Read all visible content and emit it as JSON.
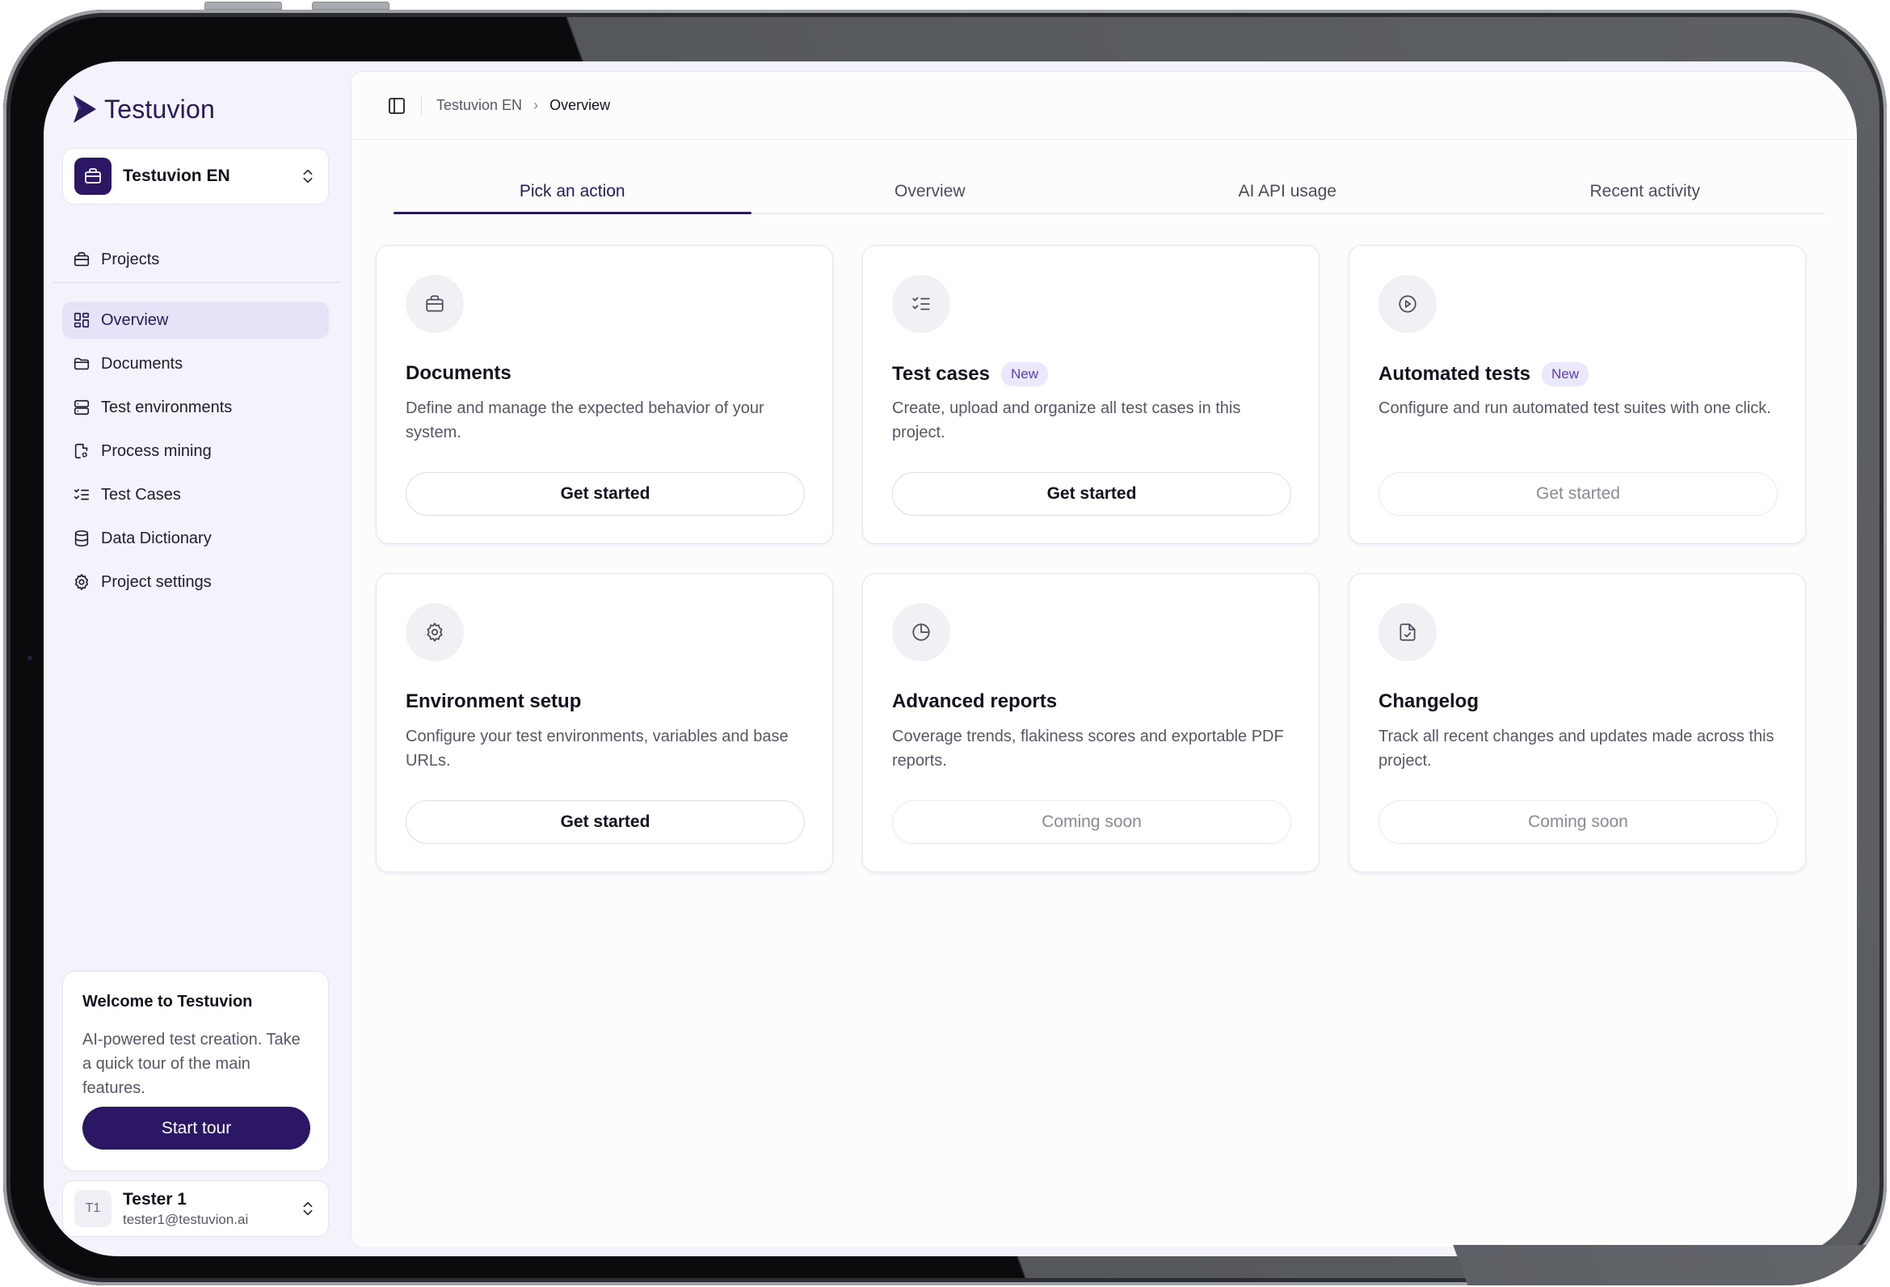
{
  "brand": {
    "name": "Testuvion"
  },
  "workspace": {
    "name": "Testuvion EN"
  },
  "sidebar": {
    "projects_label": "Projects",
    "items": [
      {
        "label": "Overview",
        "icon": "grid-icon"
      },
      {
        "label": "Documents",
        "icon": "folder-icon"
      },
      {
        "label": "Test environments",
        "icon": "server-icon"
      },
      {
        "label": "Process mining",
        "icon": "file-search-icon"
      },
      {
        "label": "Test Cases",
        "icon": "list-checks-icon"
      },
      {
        "label": "Data Dictionary",
        "icon": "database-icon"
      },
      {
        "label": "Project settings",
        "icon": "gear-icon"
      }
    ]
  },
  "welcome": {
    "title": "Welcome to Testuvion",
    "text": "AI-powered test creation. Take a quick tour of the main features.",
    "button": "Start tour"
  },
  "user": {
    "initials": "T1",
    "name": "Tester 1",
    "email": "tester1@testuvion.ai"
  },
  "breadcrumb": {
    "workspace": "Testuvion EN",
    "current": "Overview"
  },
  "tabs": [
    "Pick an action",
    "Overview",
    "AI API usage",
    "Recent activity"
  ],
  "cards": [
    {
      "title": "Documents",
      "badge": "",
      "desc": "Define and manage the expected behavior of your system.",
      "button": "Get started",
      "icon": "briefcase-icon"
    },
    {
      "title": "Test cases",
      "badge": "New",
      "desc": "Create, upload and organize all test cases in this project.",
      "button": "Get started",
      "icon": "list-checks-icon"
    },
    {
      "title": "Automated tests",
      "badge": "New",
      "desc": "Configure and run automated test suites with one click.",
      "button": "Get started",
      "icon": "play-circle-icon"
    },
    {
      "title": "Environment setup",
      "badge": "",
      "desc": "Configure your test environments, variables and base URLs.",
      "button": "Get started",
      "icon": "gear-icon"
    },
    {
      "title": "Advanced reports",
      "badge": "",
      "desc": "Coverage trends, flakiness scores and exportable PDF reports.",
      "button": "Coming soon",
      "icon": "pie-chart-icon"
    },
    {
      "title": "Changelog",
      "badge": "",
      "desc": "Track all recent changes and updates made across this project.",
      "button": "Coming soon",
      "icon": "file-check-icon"
    }
  ],
  "colors": {
    "accent": "#2b1764",
    "sidebar_bg": "#f4f2fb",
    "badge_bg": "#ece8fb",
    "badge_text": "#5a3eb8"
  }
}
